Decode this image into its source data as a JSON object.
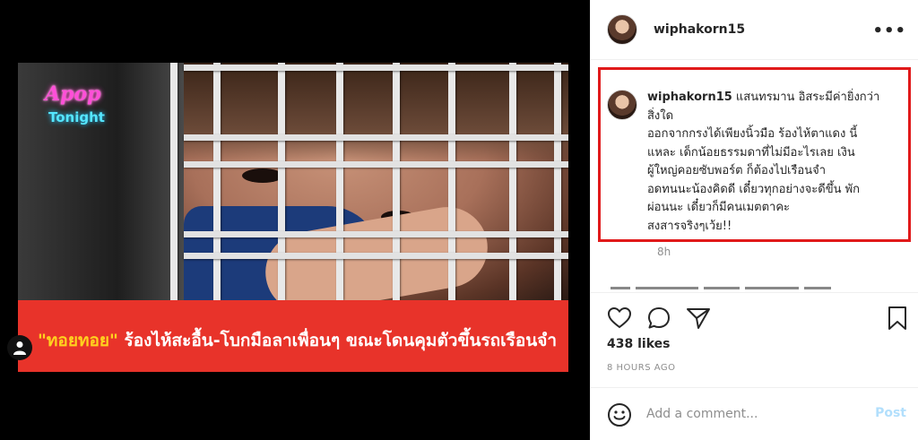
{
  "media": {
    "logo": {
      "top": "Apop",
      "bottom": "Tonight"
    },
    "caption": {
      "highlight": "\"ทอยทอย\"",
      "rest": " ร้องไห้สะอื้น-โบกมือลาเพื่อนๆ ขณะโดนคุมตัวขึ้นรถเรือนจำ"
    },
    "user_tag_icon": "person-icon"
  },
  "post": {
    "header": {
      "username": "wiphakorn15",
      "more_icon": "more-options-icon",
      "more_label": "•••"
    },
    "comment": {
      "username": "wiphakorn15",
      "lines": [
        " แสนทรมาน อิสระมีค่ายิ่งกว่า",
        "สิ่งใด",
        "ออกจากกรงได้เพียงนิ้วมือ ร้องไห้ตาแดง นี้",
        "แหละ เด็กน้อยธรรมดาที่ไม่มีอะไรเลย เงิน",
        "ผู้ใหญ่คอยซับพอร์ต ก็ต้องไปเรือนจำ",
        "อดทนนะน้องคิดดี เดี๋ยวทุกอย่างจะดีขึ้น พัก",
        "ผ่อนนะ เดี๋ยวก็มีคนเมตตาคะ",
        "สงสารจริงๆเว้ย!!"
      ],
      "time": "8h",
      "highlight_color": "#e0191a"
    },
    "actions": {
      "icons": [
        "heart-icon",
        "comment-icon",
        "share-icon",
        "bookmark-icon"
      ],
      "likes": "438 likes",
      "posted_ago": "8 HOURS AGO"
    },
    "add_comment": {
      "placeholder": "Add a comment...",
      "post_label": "Post",
      "icon": "emoji-icon"
    }
  }
}
